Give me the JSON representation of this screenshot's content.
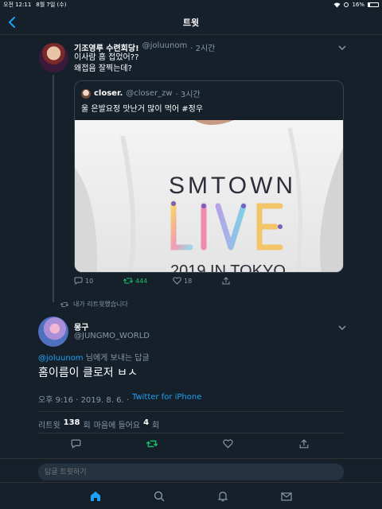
{
  "status_bar": {
    "time": "오전 12:11",
    "date": "8월 7일 (수)",
    "battery": "16%"
  },
  "nav": {
    "title": "트윗"
  },
  "parent_tweet": {
    "name": "기조영루 수련회당!",
    "handle": "@joluunom",
    "time": "· 2시간",
    "text_line1": "이사람 홈 접었어??",
    "text_line2": "왜접음 잘찍는데?",
    "quote": {
      "name": "closer.",
      "handle": "@closer_zw",
      "time": "· 3시간",
      "text": "울 은발요정 맛난거 많이 먹어 #정우",
      "media": {
        "line1": "SMTOWN",
        "line2": "LIVE",
        "line3": "2019 IN TOKYO"
      }
    },
    "actions": {
      "replies": "10",
      "retweets": "444",
      "likes": "18"
    }
  },
  "retweet_note": "내가 리트윗했습니다",
  "main_tweet": {
    "name": "몽구",
    "handle": "@JUNGMO_WORLD",
    "reply_to_mention": "@joluunom",
    "reply_to_suffix": " 님에게 보내는 답글",
    "text": "홈이름이 클로저 ㅂㅅ",
    "timestamp": "오후 9:16 · 2019. 8. 6. ·",
    "source": "Twitter for iPhone",
    "stats": {
      "retweets_label": "리트윗",
      "retweets_count": "138",
      "retweets_unit": "회",
      "likes_label": "마음에 들어요",
      "likes_count": "4",
      "likes_unit": "회"
    }
  },
  "reply_box": {
    "placeholder": "답글 트윗하기"
  },
  "colors": {
    "background": "#15202b",
    "accent": "#1da1f2",
    "retweet_green": "#17bf63",
    "muted": "#8899a6"
  }
}
